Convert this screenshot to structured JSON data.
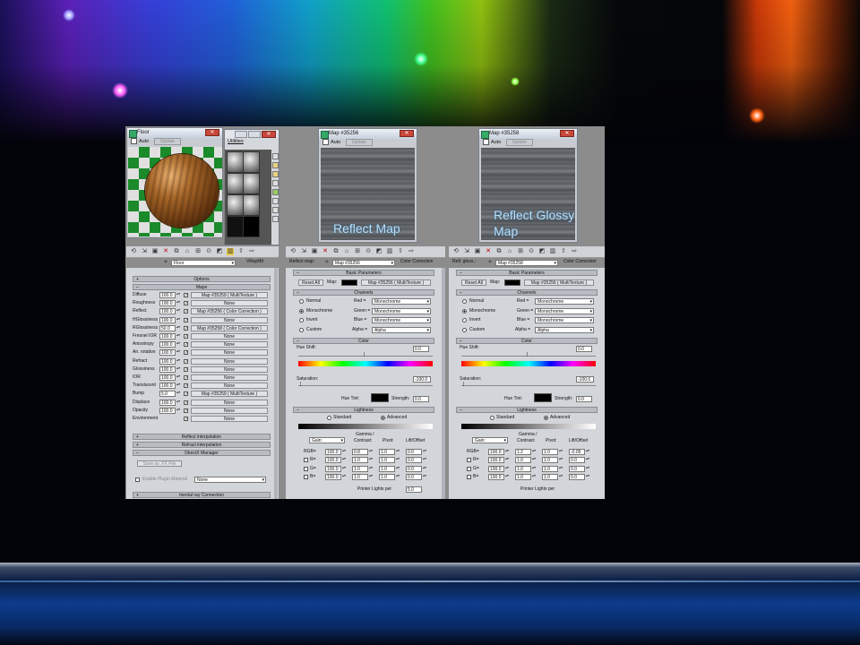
{
  "floor": {
    "title": "Floor",
    "auto": "Auto",
    "update": "Update",
    "material_name": "Floor",
    "material_type": "VRayMtl",
    "rollouts": {
      "options": "Options",
      "maps": "Maps",
      "reflect_interp": "Reflect interpolation",
      "refract_interp": "Refract interpolation",
      "directx": "DirectX Manager",
      "mental_ray": "mental ray Connection"
    },
    "maps": [
      {
        "label": "Diffuse",
        "value": "100.0",
        "map": "Map #35259  ( MultiTexture )"
      },
      {
        "label": "Roughness",
        "value": "100.0",
        "map": "None"
      },
      {
        "label": "Reflect",
        "value": "100.0",
        "map": "Map #35256  ( Color Correction )"
      },
      {
        "label": "HGlossiness",
        "value": "100.0",
        "map": "None"
      },
      {
        "label": "RGlossiness",
        "value": "50.0",
        "map": "Map #35258  ( Color Correction )"
      },
      {
        "label": "Fresnel IOR",
        "value": "100.0",
        "map": "None"
      },
      {
        "label": "Anisotropy",
        "value": "100.0",
        "map": "None"
      },
      {
        "label": "An. rotation",
        "value": "100.0",
        "map": "None"
      },
      {
        "label": "Refract",
        "value": "100.0",
        "map": "None"
      },
      {
        "label": "Glossiness",
        "value": "100.0",
        "map": "None"
      },
      {
        "label": "IOR",
        "value": "100.0",
        "map": "None"
      },
      {
        "label": "Translucent",
        "value": "100.0",
        "map": "None"
      },
      {
        "label": "Bump",
        "value": "5.0",
        "map": "Map #35259  ( MultiTexture )"
      },
      {
        "label": "Displace",
        "value": "100.0",
        "map": "None"
      },
      {
        "label": "Opacity",
        "value": "100.0",
        "map": "None"
      },
      {
        "label": "Environment",
        "value": "",
        "map": "None"
      }
    ],
    "save_fx": "Save as .FX File",
    "enable_plugin": "Enable Plugin Material",
    "plugin_value": "None"
  },
  "utilities": {
    "title": "Utilities"
  },
  "map1": {
    "title": "Map #35256",
    "auto": "Auto",
    "update": "Update",
    "preview_label": "Reflect Map",
    "slot_label": "Reflect map:",
    "map_name": "Map #35256",
    "map_type": "Color Correction"
  },
  "map2": {
    "title": "Map #35258",
    "auto": "Auto",
    "update": "Update",
    "preview_label_1": "Reflect Glossy",
    "preview_label_2": "Map",
    "slot_label": "Refl. gloss.:",
    "map_name": "Map #35258",
    "map_type": "Color Correction"
  },
  "cc": {
    "basic_params": "Basic Parameters",
    "reset_all": "Reset All",
    "map_lbl": "Map:",
    "map_ref": "Map #35256  ( MultiTexture )",
    "channels": "Channels",
    "normal": "Normal",
    "monochrome": "Monochrome",
    "invert": "Invert",
    "custom": "Custom",
    "red": "Red =",
    "green": "Green =",
    "blue": "Blue =",
    "alpha": "Alpha =",
    "mono_val": "Monochrome",
    "alpha_val": "Alpha",
    "color": "Color",
    "hue_shift": "Hue Shift:",
    "hue_val": "0.0",
    "saturation": "Saturation:",
    "sat_val": "-100.0",
    "hue_tint": "Hue Tint:",
    "strength": "Strength:",
    "strength_val": "0.0",
    "lightness": "Lightness",
    "standard": "Standard",
    "advanced": "Advanced",
    "gain": "Gain:",
    "gamma_contrast_1": "Gamma /",
    "gamma_contrast_2": "Contrast:",
    "pivot": "Pivot:",
    "lift_offset": "Lift/Offset",
    "rgb": "RGB=",
    "r": "R=",
    "g": "G=",
    "b": "B=",
    "printer": "Printer Lights per"
  },
  "cc1_values": {
    "rgb": [
      "100.0",
      "0.8",
      "1.0",
      "0.0"
    ],
    "r": [
      "100.0",
      "1.0",
      "1.0",
      "0.0"
    ],
    "g": [
      "100.0",
      "1.0",
      "1.0",
      "0.0"
    ],
    "b": [
      "100.0",
      "1.0",
      "1.0",
      "0.0"
    ],
    "printer": "5.0"
  },
  "cc2_values": {
    "rgb": [
      "100.0",
      "1.2",
      "1.0",
      "-0.05"
    ],
    "r": [
      "100.0",
      "1.0",
      "1.0",
      "0.0"
    ],
    "g": [
      "100.0",
      "1.0",
      "1.0",
      "0.0"
    ],
    "b": [
      "100.0",
      "1.0",
      "1.0",
      "0.0"
    ]
  }
}
